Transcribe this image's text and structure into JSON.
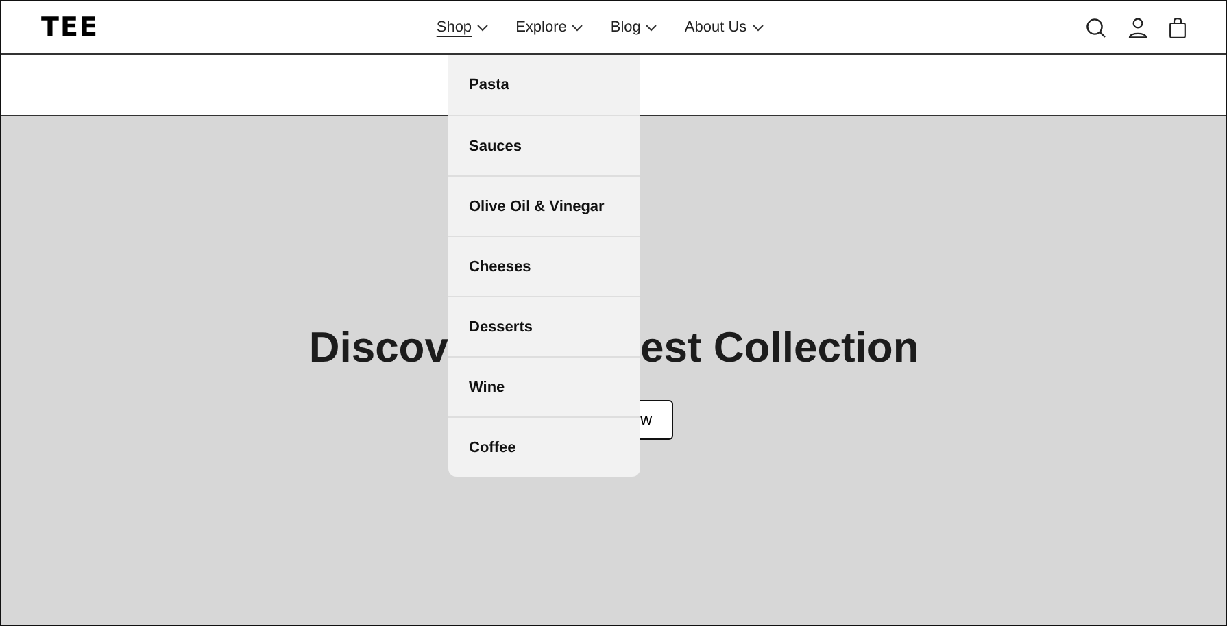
{
  "logo": "TEE",
  "nav": [
    {
      "label": "Shop",
      "selected": true
    },
    {
      "label": "Explore",
      "selected": false
    },
    {
      "label": "Blog",
      "selected": false
    },
    {
      "label": "About Us",
      "selected": false
    }
  ],
  "dropdown": [
    "Pasta",
    "Sauces",
    "Olive Oil & Vinegar",
    "Cheeses",
    "Desserts",
    "Wine",
    "Coffee"
  ],
  "hero": {
    "heading_left": "Discov",
    "heading_right": "est Collection",
    "button": "w"
  }
}
